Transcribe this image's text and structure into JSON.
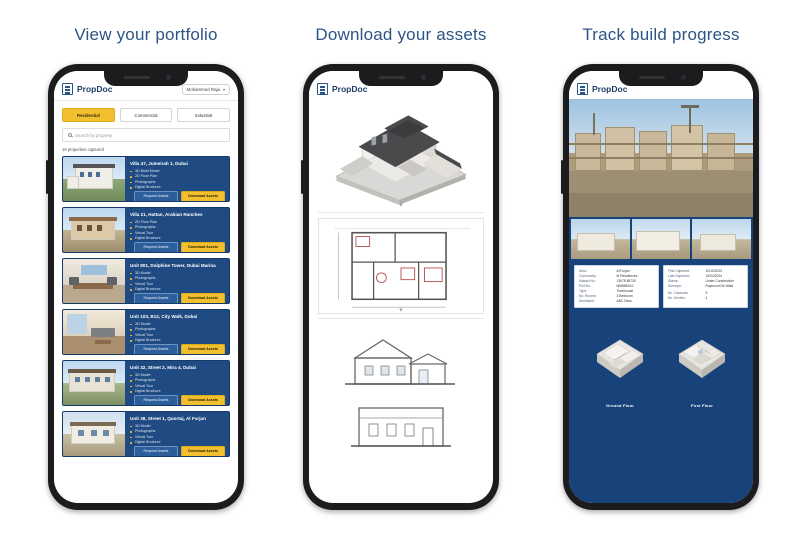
{
  "panels": [
    {
      "title": "View your portfolio"
    },
    {
      "title": "Download your assets"
    },
    {
      "title": "Track build progress"
    }
  ],
  "app": {
    "brand": "PropDoc",
    "brand_icon": "document-building-icon",
    "user_menu": "Mohammed Raja",
    "caret_icon": "chevron-down-icon"
  },
  "portfolio": {
    "filters": [
      {
        "label": "Residential",
        "active": true
      },
      {
        "label": "Commercial",
        "active": false
      },
      {
        "label": "Industrial",
        "active": false
      }
    ],
    "search_placeholder": "Search by property",
    "search_value": "",
    "search_icon": "search-icon",
    "count_text": "16 properties captured",
    "request_label": "Request Assets",
    "download_label": "Download Assets",
    "cards": [
      {
        "title": "Villa 47, Jumeirah 1, Dubai",
        "features": [
          "3D Build Model",
          "2D Floor Plan",
          "Photographs",
          "Digital Brochure"
        ]
      },
      {
        "title": "Villa 21, Hattan, Arabian Ranches",
        "features": [
          "2D Floor Plan",
          "Photographs",
          "Virtual Tour",
          "Digital Brochure"
        ]
      },
      {
        "title": "Unit 801, Dolphine Tower, Dubai Marina",
        "features": [
          "3D Model",
          "Photographs",
          "Virtual Tour",
          "Digital Brochure"
        ]
      },
      {
        "title": "Unit 103, B12, City Walk, Dubai",
        "features": [
          "3D Model",
          "Photographs",
          "Virtual Tour",
          "Digital Brochure"
        ]
      },
      {
        "title": "Unit 32, Street 2, Mira 4, Dubai",
        "features": [
          "3D Model",
          "Photographs",
          "Virtual Tour",
          "Digital Brochure"
        ]
      },
      {
        "title": "Unit 38, Street 1, Quortaj, Al Furjan",
        "features": [
          "3D Model",
          "Photographs",
          "Virtual Tour",
          "Digital Brochure"
        ]
      }
    ]
  },
  "assets": {
    "items": [
      {
        "name": "3d-build-model"
      },
      {
        "name": "2d-floor-plan"
      },
      {
        "name": "section-elevation"
      },
      {
        "name": "front-elevation"
      }
    ],
    "scroll_icon": "chevron-down-icon"
  },
  "progress": {
    "hero_name": "construction-site-photo",
    "thumbs": [
      "site-photo-1",
      "site-photo-2",
      "site-photo-3"
    ],
    "info_left": [
      {
        "key": "Area:",
        "value": "Al Furjan"
      },
      {
        "key": "Community:",
        "value": "M Residences"
      },
      {
        "key": "Makani No:",
        "value": "13678 88730"
      },
      {
        "key": "Plot No:",
        "value": "MM855204"
      },
      {
        "key": "Type:",
        "value": "Townhouse"
      },
      {
        "key": "No. Rooms:",
        "value": "3 Bedroom"
      },
      {
        "key": "Developer:",
        "value": "ABC Devs"
      }
    ],
    "info_right": [
      {
        "key": "First Captured:",
        "value": "10/12/2023"
      },
      {
        "key": "Last Captured:",
        "value": "10/04/2024"
      },
      {
        "key": "Status:",
        "value": "Under Construction"
      },
      {
        "key": "Surveyor:",
        "value": "Raymond De Waal"
      },
      {
        "key": "No. Captures:",
        "value": "5"
      },
      {
        "key": "No. Months:",
        "value": "4"
      }
    ],
    "floor_plans": [
      {
        "label": "Ground Floor"
      },
      {
        "label": "First Floor"
      }
    ]
  },
  "colors": {
    "heading": "#2b5586",
    "card_blue": "#1f4b82",
    "accent_yellow": "#f2c02e",
    "deep_blue": "#17427a"
  }
}
